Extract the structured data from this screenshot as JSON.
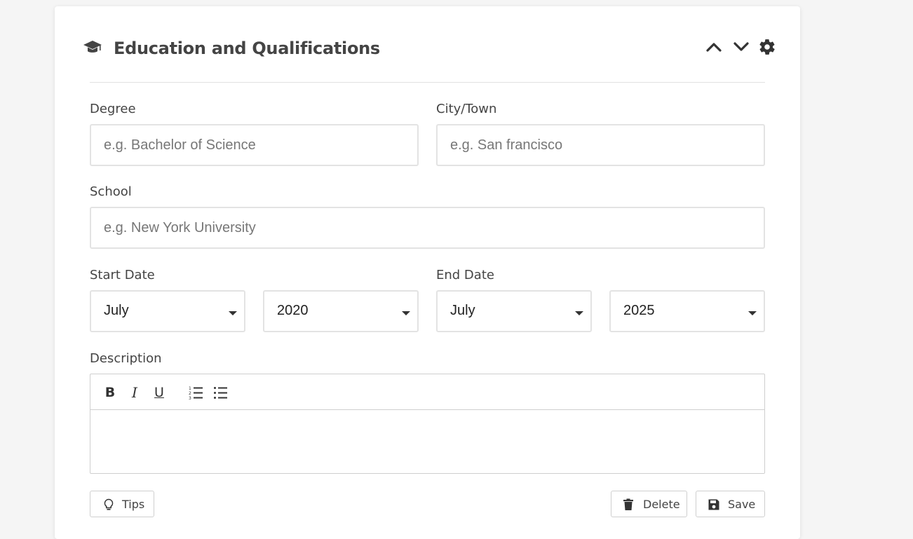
{
  "section": {
    "title": "Education and Qualifications",
    "icons": {
      "section": "graduation-cap-icon",
      "move_up": "chevron-up-icon",
      "move_down": "chevron-down-icon",
      "settings": "gear-icon"
    }
  },
  "form": {
    "degree": {
      "label": "Degree",
      "placeholder": "e.g. Bachelor of Science",
      "value": ""
    },
    "city": {
      "label": "City/Town",
      "placeholder": "e.g. San francisco",
      "value": ""
    },
    "school": {
      "label": "School",
      "placeholder": "e.g. New York University",
      "value": ""
    },
    "start_date": {
      "label": "Start Date",
      "month": "July",
      "year": "2020"
    },
    "end_date": {
      "label": "End Date",
      "month": "July",
      "year": "2025"
    },
    "description": {
      "label": "Description",
      "toolbar": {
        "bold": "B",
        "italic": "I",
        "underline": "U"
      },
      "content": ""
    }
  },
  "actions": {
    "tips": "Tips",
    "delete": "Delete",
    "save": "Save"
  }
}
